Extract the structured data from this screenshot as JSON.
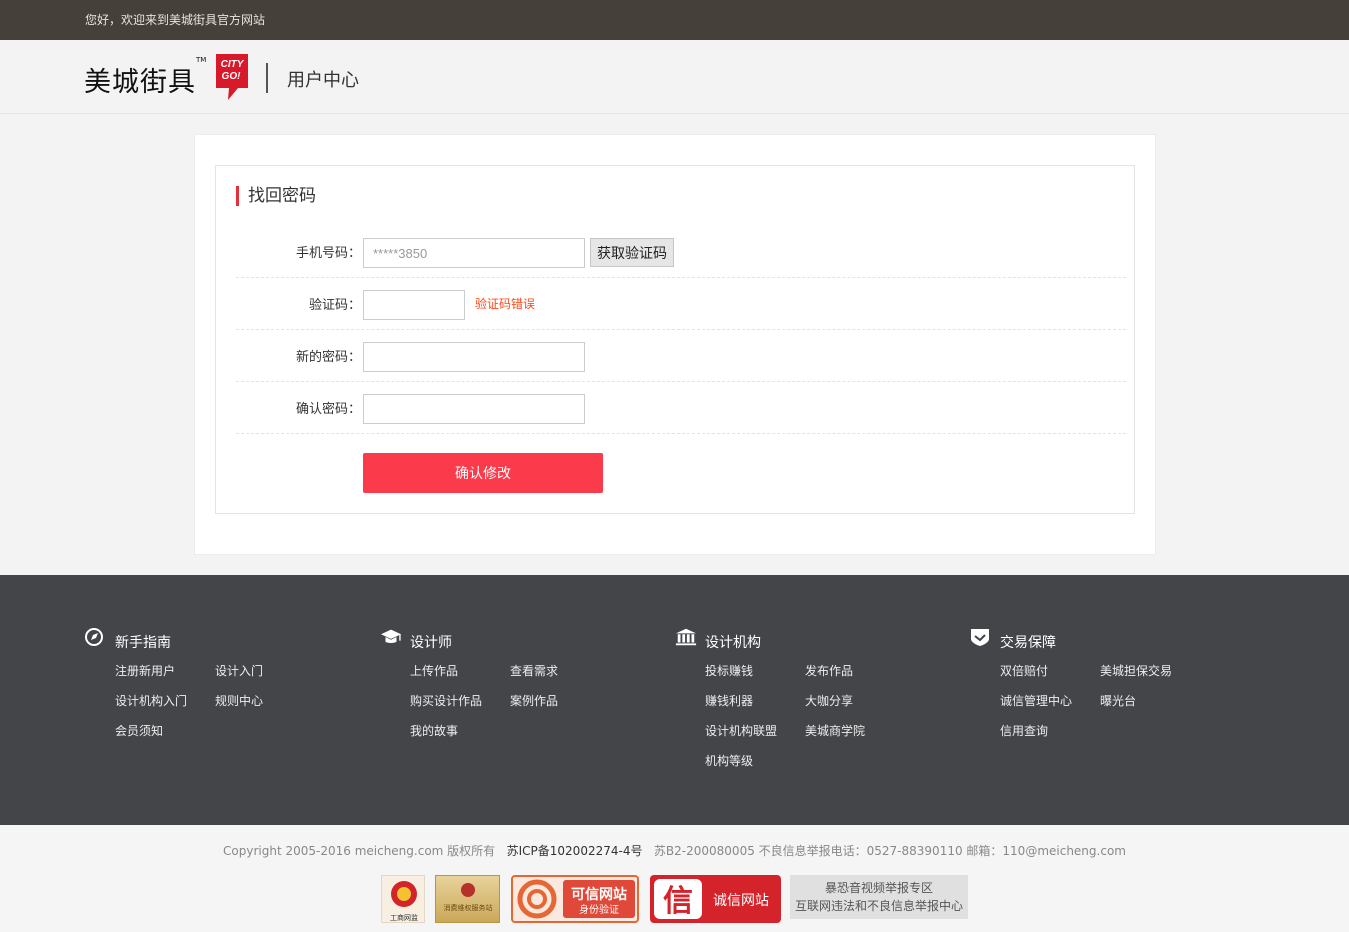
{
  "topbar": {
    "welcome": "您好，欢迎来到美城街具官方网站"
  },
  "header": {
    "brand_name": "美城街具",
    "logo_text_line1": "CITY",
    "logo_text_line2": "GO!",
    "tm": "TM",
    "section_title": "用户中心"
  },
  "form": {
    "title": "找回密码",
    "phone_label": "手机号码：",
    "phone_placeholder": "*****3850",
    "get_code_label": "获取验证码",
    "code_label": "验证码：",
    "code_error": "验证码错误",
    "new_password_label": "新的密码：",
    "confirm_password_label": "确认密码：",
    "submit_label": "确认修改"
  },
  "footer": {
    "columns": [
      {
        "title": "新手指南",
        "icon": "compass-icon",
        "links": [
          "注册新用户",
          "设计入门",
          "设计机构入门",
          "规则中心",
          "会员须知"
        ]
      },
      {
        "title": "设计师",
        "icon": "graduation-cap-icon",
        "links": [
          "上传作品",
          "查看需求",
          "购买设计作品",
          "案例作品",
          "我的故事"
        ]
      },
      {
        "title": "设计机构",
        "icon": "bank-icon",
        "links": [
          "投标赚钱",
          "发布作品",
          "赚钱利器",
          "大咖分享",
          "设计机构联盟",
          "美城商学院",
          "机构等级"
        ]
      },
      {
        "title": "交易保障",
        "icon": "shield-check-icon",
        "links": [
          "双倍赔付",
          "美城担保交易",
          "诚信管理中心",
          "曝光台",
          "信用查询"
        ]
      }
    ]
  },
  "bottom": {
    "copyright": "Copyright 2005-2016 meicheng.com 版权所有",
    "icp": "苏ICP备102002274-4号",
    "license_contact": "苏B2-200080005 不良信息举报电话：0527-88390110 邮箱：110@meicheng.com",
    "badge1_text": "工商网监",
    "badge2_text": "消费维权服务站",
    "badge3_text_main": "可信网站",
    "badge3_text_sub": "身份验证",
    "badge4_text_char": "信",
    "badge4_text": "诚信网站",
    "badge5_line1": "暴恐音视频举报专区",
    "badge5_line2": "互联网违法和不良信息举报中心"
  },
  "colors": {
    "topbar_bg": "#46403a",
    "accent_red": "#fb3b4b",
    "error_orange": "#ff4a18",
    "footer_bg": "#444549"
  }
}
